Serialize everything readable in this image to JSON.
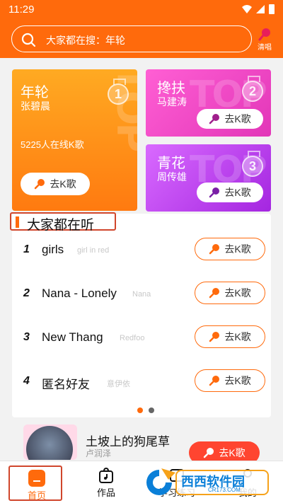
{
  "status_bar": {
    "time": "11:29"
  },
  "search": {
    "text": "大家都在搜：年轮"
  },
  "sing_button": {
    "label": "清唱"
  },
  "featured_cards": [
    {
      "title": "年轮",
      "artist": "张碧晨",
      "online": "5225人在线K歌",
      "rank": "1",
      "ghost": "TOP",
      "button": "去K歌",
      "color": "#ff8a14"
    },
    {
      "title": "搀扶",
      "artist": "马建涛",
      "rank": "2",
      "ghost": "TOP",
      "button": "去K歌",
      "color": "#ee48c8"
    },
    {
      "title": "青花",
      "artist": "周传雄",
      "rank": "3",
      "ghost": "TOP",
      "button": "去K歌",
      "color": "#bf44ee"
    }
  ],
  "section": {
    "title": "大家都在听"
  },
  "songs": [
    {
      "rank": "1",
      "title": "girls",
      "singer": "girl in red",
      "button": "去K歌"
    },
    {
      "rank": "2",
      "title": "Nana - Lonely",
      "singer": "Nana",
      "button": "去K歌"
    },
    {
      "rank": "3",
      "title": "New Thang",
      "singer": "Redfoo",
      "button": "去K歌"
    },
    {
      "rank": "4",
      "title": "匿名好友",
      "singer": "意伊依",
      "button": "去K歌"
    }
  ],
  "pager": {
    "total": 2,
    "active": 0
  },
  "feature_item": {
    "title": "土坡上的狗尾草",
    "artist": "卢润泽",
    "button": "去K歌"
  },
  "nav": {
    "home": "首页",
    "works": "作品",
    "learn": "学习练习",
    "mine": "我的"
  },
  "watermark": {
    "name": "西西软件园",
    "url": "CR173.COM"
  },
  "colors": {
    "accent": "#ff6a0c",
    "highlight_border": "#d0462c",
    "feature_button": "#ff4530"
  }
}
